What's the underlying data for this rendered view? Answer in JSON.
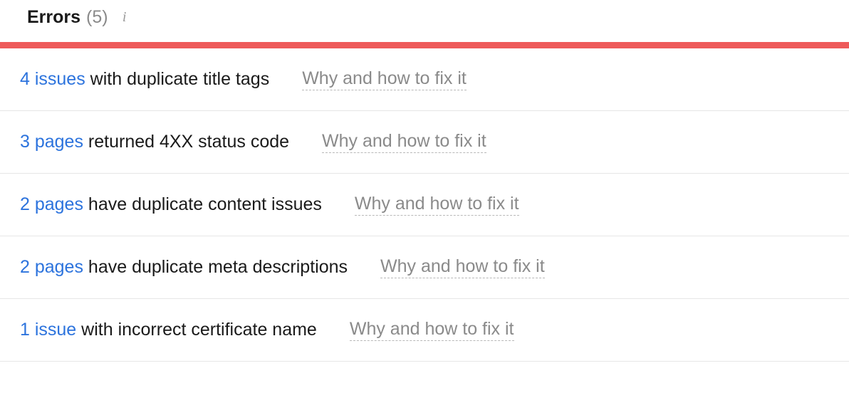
{
  "header": {
    "title": "Errors",
    "count_text": "(5)",
    "info_glyph": "i"
  },
  "fix_link_label": "Why and how to fix it",
  "issues": [
    {
      "link_text": "4 issues",
      "rest_text": " with duplicate title tags"
    },
    {
      "link_text": "3 pages",
      "rest_text": " returned 4XX status code"
    },
    {
      "link_text": "2 pages",
      "rest_text": " have duplicate content issues"
    },
    {
      "link_text": "2 pages",
      "rest_text": " have duplicate meta descriptions"
    },
    {
      "link_text": "1 issue",
      "rest_text": " with incorrect certificate name"
    }
  ]
}
